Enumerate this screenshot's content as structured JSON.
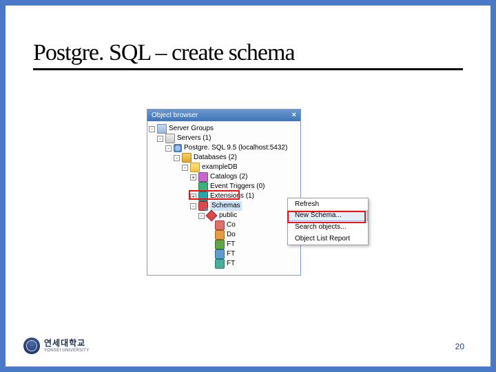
{
  "slide": {
    "title": "Postgre. SQL – create schema",
    "page_number": "20"
  },
  "logo": {
    "korean": "연세대학교",
    "english": "YONSEI UNIVERSITY"
  },
  "panel": {
    "title": "Object browser"
  },
  "tree": {
    "server_groups": "Server Groups",
    "servers": "Servers (1)",
    "pg": "Postgre. SQL 9.5 (localhost:5432)",
    "databases": "Databases (2)",
    "exampledb": "exampleDB",
    "catalogs": "Catalogs (2)",
    "event_triggers": "Event Triggers (0)",
    "extensions": "Extensions (1)",
    "schemas": "Schemas",
    "public": "public",
    "cut1": "Co",
    "cut2": "Do",
    "cut3": "FT",
    "cut4": "FT",
    "cut5": "FT"
  },
  "context_menu": {
    "refresh": "Refresh",
    "new_schema": "New Schema...",
    "search": "Search objects...",
    "report": "Object List Report"
  }
}
